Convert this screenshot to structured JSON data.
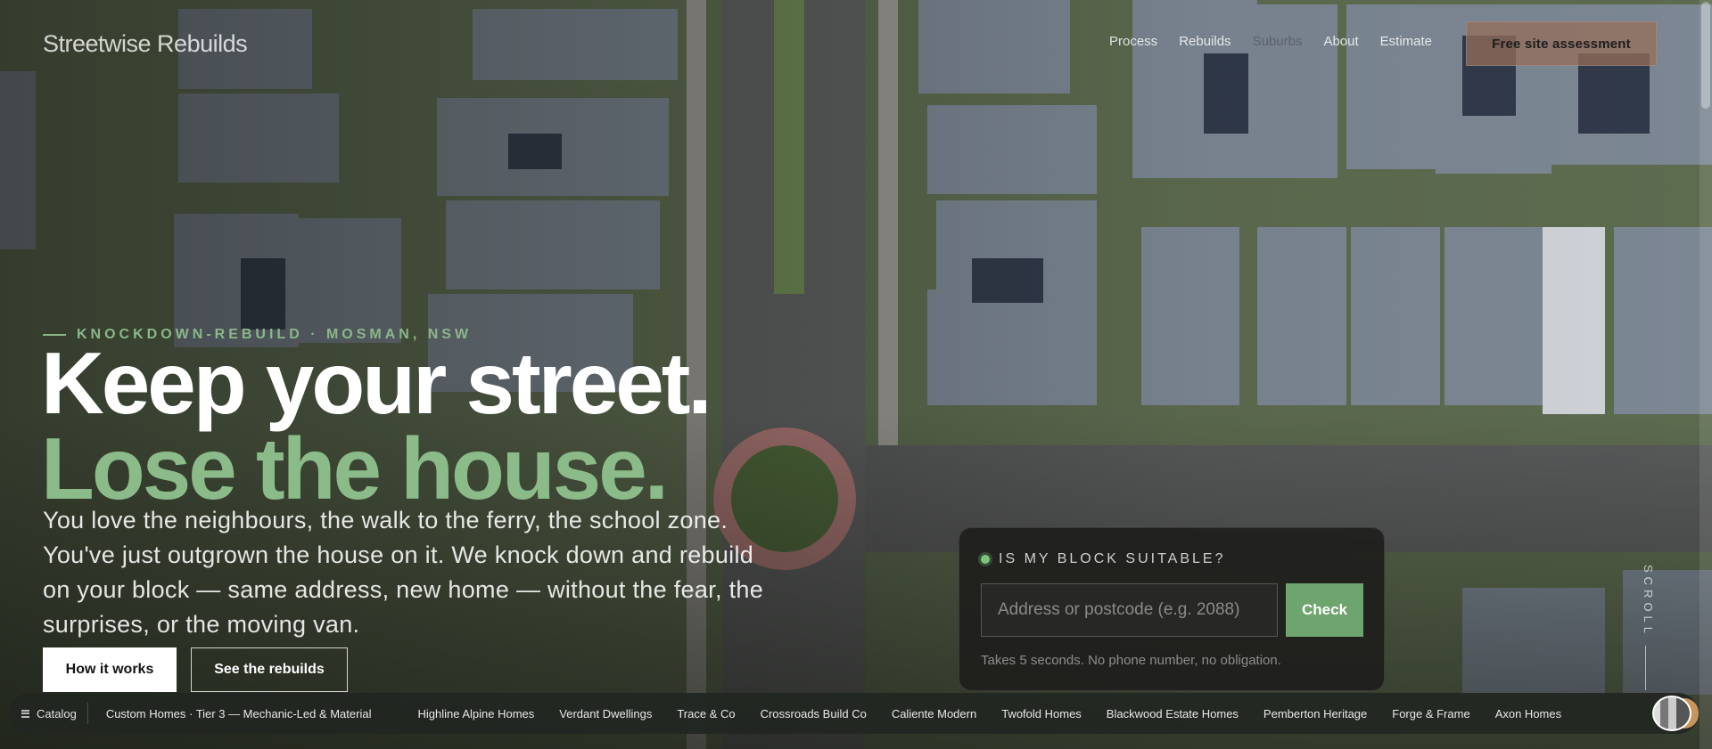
{
  "header": {
    "logo": "Streetwise Rebuilds",
    "nav": [
      "Process",
      "Rebuilds",
      "Suburbs",
      "About",
      "Estimate"
    ],
    "cta": "Free site assessment"
  },
  "hero": {
    "eyebrow": "KNOCKDOWN-REBUILD · MOSMAN, NSW",
    "headline_line1": "Keep your street.",
    "headline_line2": "Lose the house.",
    "lede": "You love the neighbours, the walk to the ferry, the school zone. You've just outgrown the house on it. We knock down and rebuild on your block — same address, new home — without the fear, the surprises, or the moving van.",
    "primary_button": "How it works",
    "secondary_button": "See the rebuilds"
  },
  "suitability": {
    "title": "IS MY BLOCK SUITABLE?",
    "input_placeholder": "Address or postcode (e.g. 2088)",
    "button": "Check",
    "note": "Takes 5 seconds. No phone number, no obligation."
  },
  "scroll_label": "SCROLL",
  "catalog": {
    "label": "Catalog",
    "tier": "Custom Homes · Tier 3 — Mechanic-Led & Material",
    "items": [
      "Highline Alpine Homes",
      "Verdant Dwellings",
      "Trace & Co",
      "Crossroads Build Co",
      "Caliente Modern",
      "Twofold Homes",
      "Blackwood Estate Homes",
      "Pemberton Heritage",
      "Forge & Frame",
      "Axon Homes"
    ]
  },
  "colors": {
    "accent_green": "#8bbb89",
    "check_button": "#6ea46d",
    "cta_bg": "#96705a"
  }
}
